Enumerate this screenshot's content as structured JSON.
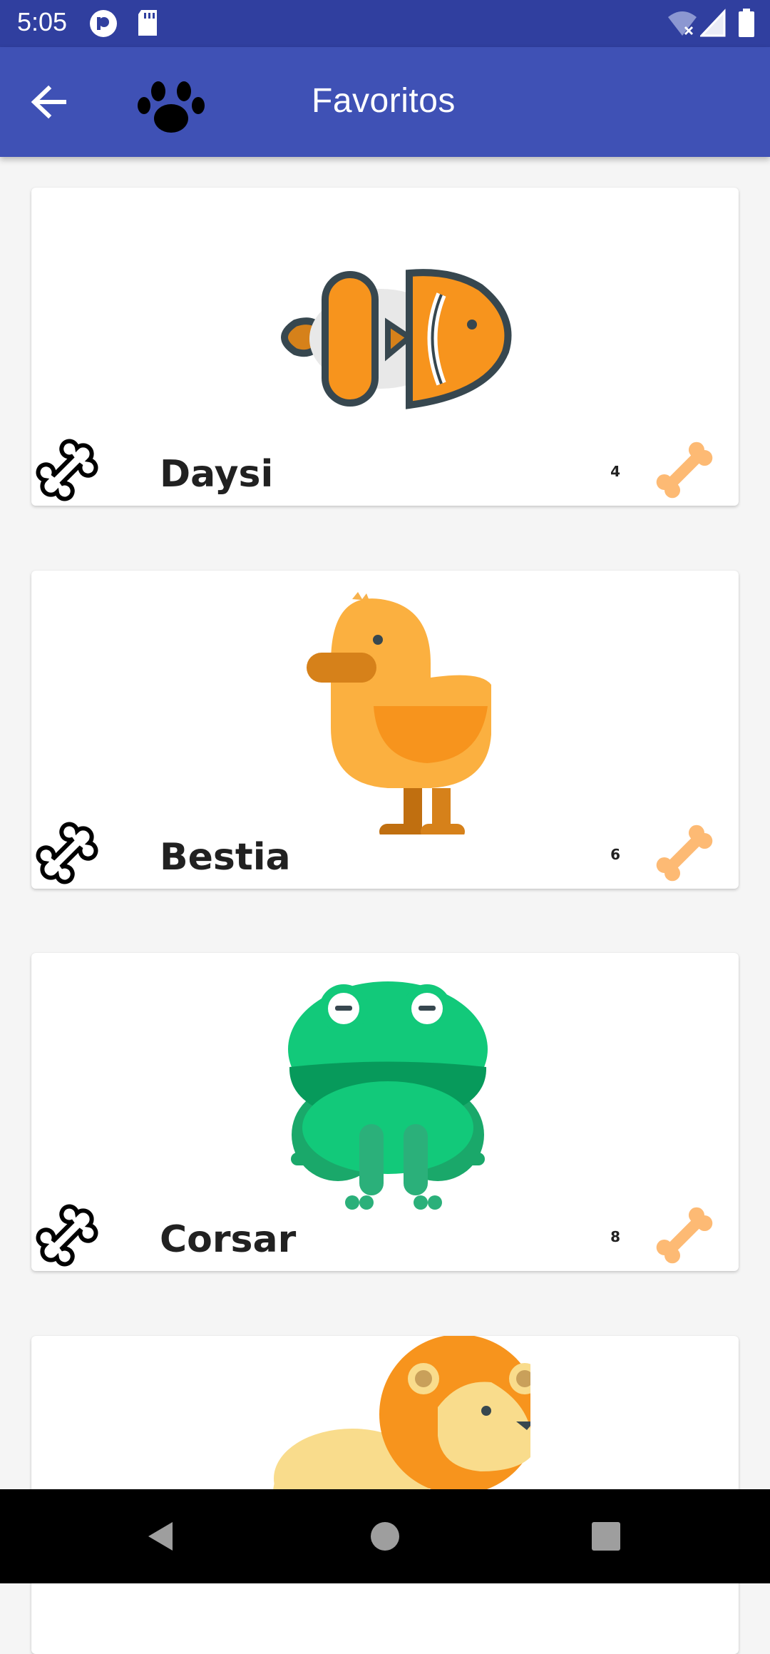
{
  "status_bar": {
    "time": "5:05",
    "icons": [
      "pocket-casts-icon",
      "sd-card-icon",
      "wifi-off-icon",
      "signal-icon",
      "battery-icon"
    ]
  },
  "app_bar": {
    "title": "Favoritos",
    "back_icon": "arrow-left-icon",
    "logo_icon": "paw-icon",
    "color": "#3F51B5",
    "status_color": "#303F9F"
  },
  "pets": [
    {
      "name": "Daysi",
      "count": "4",
      "image": "clownfish"
    },
    {
      "name": "Bestia",
      "count": "6",
      "image": "duck"
    },
    {
      "name": "Corsar",
      "count": "8",
      "image": "frog"
    },
    {
      "name": "",
      "count": "",
      "image": "lion"
    }
  ],
  "nav_bar": {
    "back": "nav-back-icon",
    "home": "nav-home-icon",
    "recents": "nav-recents-icon"
  },
  "colors": {
    "bone_outline": "#000000",
    "bone_rating": "#FDBA74"
  }
}
